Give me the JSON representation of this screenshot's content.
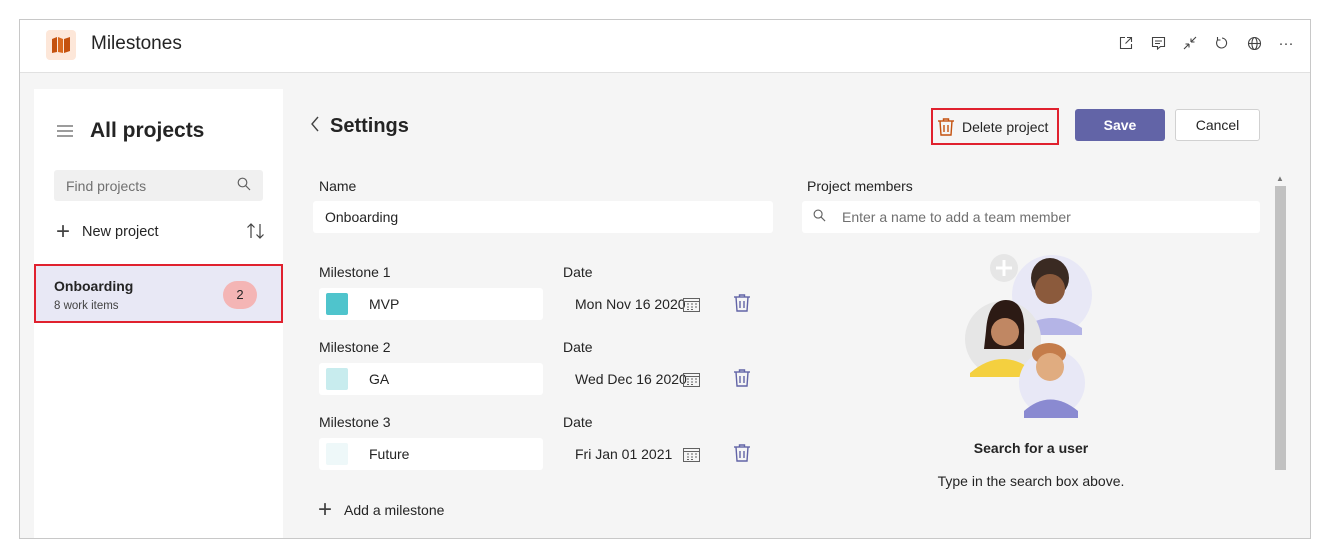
{
  "app": {
    "title": "Milestones",
    "accent": "#6264a7",
    "brand": "#c4510e",
    "top_icons": [
      "popout-icon",
      "chat-icon",
      "minimize-icon",
      "refresh-icon",
      "globe-icon",
      "more-icon"
    ],
    "more_label": "···"
  },
  "sidebar": {
    "title": "All projects",
    "search_placeholder": "Find projects",
    "new_project_label": "New project",
    "projects": [
      {
        "name": "Onboarding",
        "subtitle": "8 work items",
        "badge": "2"
      }
    ]
  },
  "settings": {
    "title": "Settings",
    "delete_label": "Delete project",
    "save_label": "Save",
    "cancel_label": "Cancel",
    "name_label": "Name",
    "name_value": "Onboarding",
    "milestones": [
      {
        "label": "Milestone 1",
        "date_label": "Date",
        "name": "MVP",
        "date": "Mon Nov 16 2020",
        "color": "#4fc4cc"
      },
      {
        "label": "Milestone 2",
        "date_label": "Date",
        "name": "GA",
        "date": "Wed Dec 16 2020",
        "color": "#c8ecee"
      },
      {
        "label": "Milestone 3",
        "date_label": "Date",
        "name": "Future",
        "date": "Fri Jan 01 2021",
        "color": "#eef8f9"
      }
    ],
    "add_milestone_label": "Add a milestone",
    "members_label": "Project members",
    "members_placeholder": "Enter a name to add a team member",
    "search_user_title": "Search for a user",
    "search_user_sub": "Type in the search box above."
  }
}
